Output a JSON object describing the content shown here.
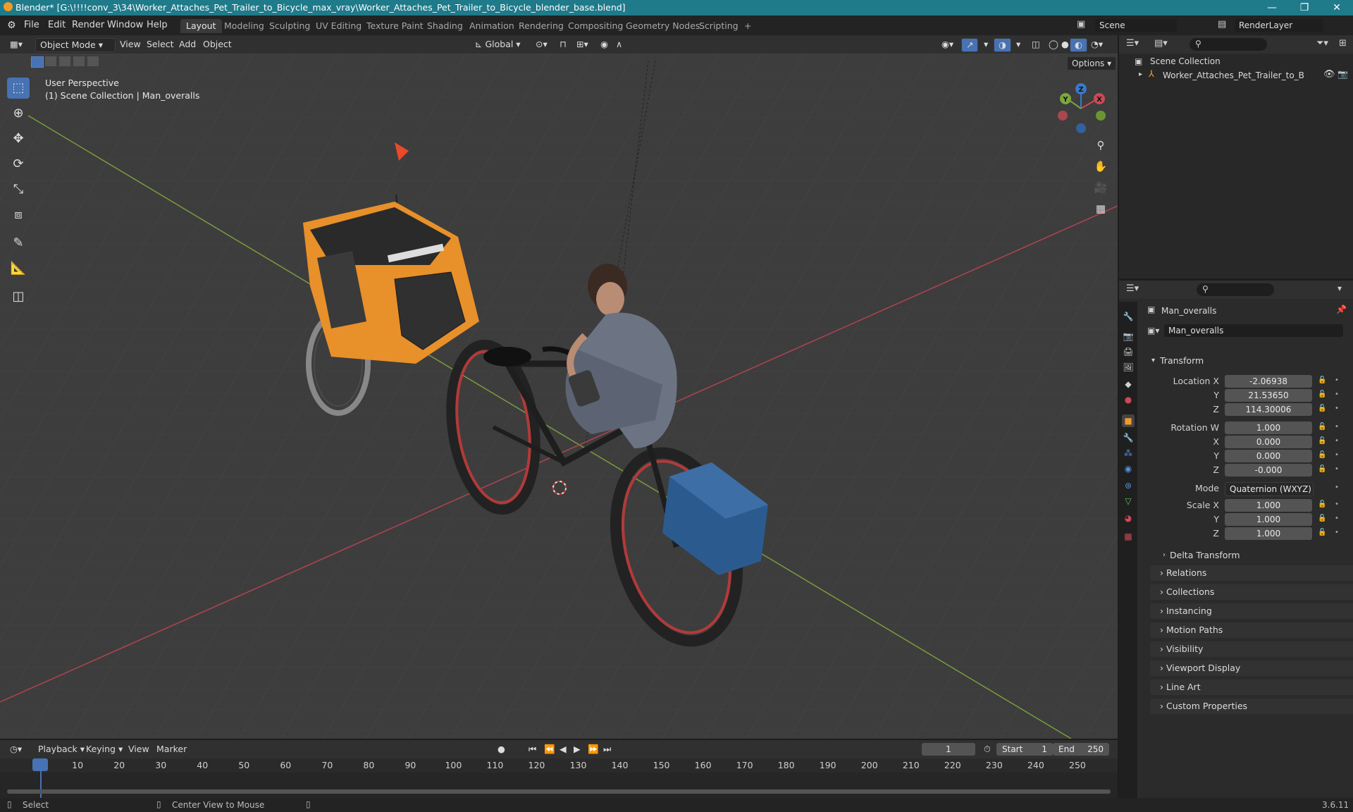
{
  "window": {
    "title": "Blender* [G:\\!!!!conv_3\\34\\Worker_Attaches_Pet_Trailer_to_Bicycle_max_vray\\Worker_Attaches_Pet_Trailer_to_Bicycle_blender_base.blend]",
    "minimize": "—",
    "maximize": "❐",
    "close": "✕"
  },
  "menubar": {
    "items": [
      "File",
      "Edit",
      "Render",
      "Window",
      "Help"
    ],
    "tabs": [
      "Layout",
      "Modeling",
      "Sculpting",
      "UV Editing",
      "Texture Paint",
      "Shading",
      "Animation",
      "Rendering",
      "Compositing",
      "Geometry Nodes",
      "Scripting"
    ],
    "add_tab": "+",
    "scene": "Scene",
    "render_layer": "RenderLayer"
  },
  "viewport_header": {
    "mode": "Object Mode",
    "menus": [
      "View",
      "Select",
      "Add",
      "Object"
    ],
    "orientation": "Global",
    "options": "Options"
  },
  "viewport": {
    "perspective": "User Perspective",
    "collection": "(1) Scene Collection | Man_overalls",
    "gizmo": {
      "x": "X",
      "y": "Y",
      "z": "Z"
    }
  },
  "outliner": {
    "root": "Scene Collection",
    "items": [
      "Worker_Attaches_Pet_Trailer_to_Bicycle"
    ]
  },
  "properties": {
    "object_name": "Man_overalls",
    "data_name": "Man_overalls",
    "transform_label": "Transform",
    "location": {
      "label": "Location X",
      "x": "-2.06938",
      "y": "21.53650",
      "z": "114.30006"
    },
    "rotation": {
      "label": "Rotation W",
      "w": "1.000",
      "x": "0.000",
      "y": "0.000",
      "z": "-0.000"
    },
    "mode_label": "Mode",
    "mode_value": "Quaternion (WXYZ)",
    "scale": {
      "label": "Scale X",
      "x": "1.000",
      "y": "1.000",
      "z": "1.000"
    },
    "axis_labels": {
      "y": "Y",
      "z": "Z",
      "x": "X"
    },
    "delta": "Delta Transform",
    "panels": [
      "Relations",
      "Collections",
      "Instancing",
      "Motion Paths",
      "Visibility",
      "Viewport Display",
      "Line Art",
      "Custom Properties"
    ]
  },
  "timeline": {
    "menus": [
      "Playback",
      "Keying",
      "View",
      "Marker"
    ],
    "current_frame": "1",
    "start_label": "Start",
    "start": "1",
    "end_label": "End",
    "end": "250",
    "frames": [
      "1",
      "10",
      "20",
      "30",
      "40",
      "50",
      "60",
      "70",
      "80",
      "90",
      "100",
      "110",
      "120",
      "130",
      "140",
      "150",
      "160",
      "170",
      "180",
      "190",
      "200",
      "210",
      "220",
      "230",
      "240",
      "250"
    ]
  },
  "statusbar": {
    "select": "Select",
    "center": "Center View to Mouse",
    "version": "3.6.11"
  }
}
